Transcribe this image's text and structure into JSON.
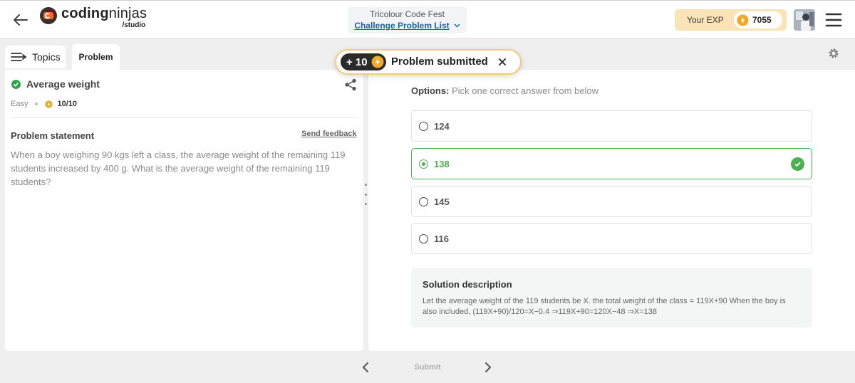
{
  "header": {
    "logo_main_a": "coding",
    "logo_main_b": "ninjas",
    "logo_sub": "/studio",
    "event_name": "Tricolour Code Fest",
    "challenge_list_label": "Challenge Problem List",
    "exp_label": "Your EXP",
    "exp_value": "7055"
  },
  "tabs": {
    "topics_label": "Topics",
    "problem_label": "Problem"
  },
  "toast": {
    "points": "+ 10",
    "message": "Problem submitted"
  },
  "problem": {
    "title": "Average weight",
    "difficulty": "Easy",
    "score": "10/10",
    "statement_label": "Problem statement",
    "feedback_label": "Send feedback",
    "statement": "When a boy weighing 90 kgs left a class, the average weight of the remaining 119 students increased by 400 g. What is the average weight of the remaining 119 students?"
  },
  "options": {
    "label": "Options:",
    "hint": "Pick one correct answer from below",
    "items": [
      {
        "text": "124"
      },
      {
        "text": "138"
      },
      {
        "text": "145"
      },
      {
        "text": "116"
      }
    ]
  },
  "solution": {
    "title": "Solution description",
    "text": "Let the average weight of the 119 students be X. the total weight of the class = 119X+90 When the boy is also included, (119X+90)/120=X−0.4 ⇒119X+90=120X−48 ⇒X=138"
  },
  "footer": {
    "submit_label": "Submit"
  },
  "colors": {
    "accent_green": "#4caf50",
    "link_blue": "#1f5fa8",
    "exp_bg": "#fae3b6",
    "coin": "#f5a623"
  }
}
